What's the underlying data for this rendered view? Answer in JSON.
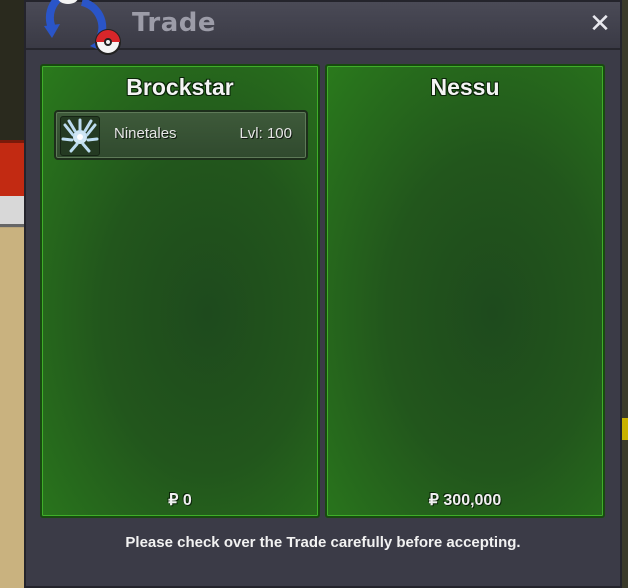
{
  "window": {
    "title": "Trade",
    "close_glyph": "✕"
  },
  "left_panel": {
    "name": "Brockstar",
    "items": [
      {
        "icon": "ninetales-icon",
        "name": "Ninetales",
        "level": "Lvl: 100"
      }
    ],
    "money": "₽ 0"
  },
  "right_panel": {
    "name": "Nessu",
    "money": "₽ 300,000"
  },
  "footer": {
    "message": "Please check over the Trade carefully before accepting."
  },
  "colors": {
    "panel_green": "#2a7a1c",
    "window_bg": "#3b3b47",
    "title_text": "#9c9ca8"
  }
}
